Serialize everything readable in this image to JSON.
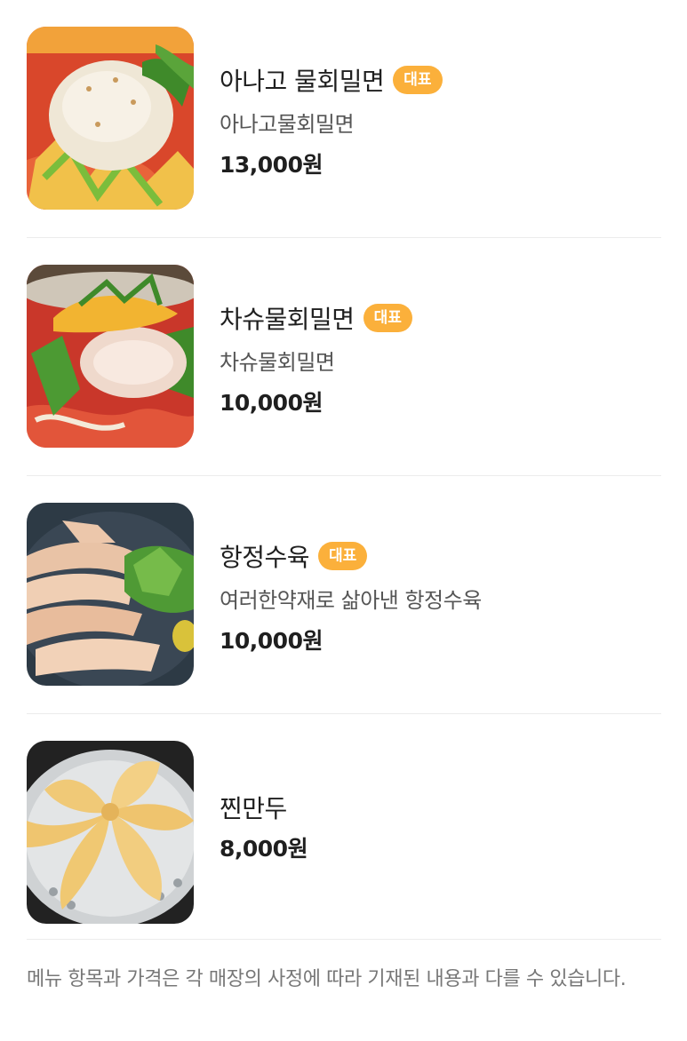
{
  "menu": {
    "items": [
      {
        "name": "아나고 물회밀면",
        "badge": "대표",
        "description": "아나고물회밀면",
        "price": "13,000원"
      },
      {
        "name": "차슈물회밀면",
        "badge": "대표",
        "description": "차슈물회밀면",
        "price": "10,000원"
      },
      {
        "name": "항정수육",
        "badge": "대표",
        "description": "여러한약재로 삶아낸 항정수육",
        "price": "10,000원"
      },
      {
        "name": "찐만두",
        "price": "8,000원"
      }
    ]
  },
  "footer": {
    "note": "메뉴 항목과 가격은 각 매장의 사정에 따라 기재된 내용과 다를 수 있습니다."
  },
  "colors": {
    "badge_background": "#fbb03b",
    "divider": "#ececec",
    "footer_text": "#777777"
  }
}
